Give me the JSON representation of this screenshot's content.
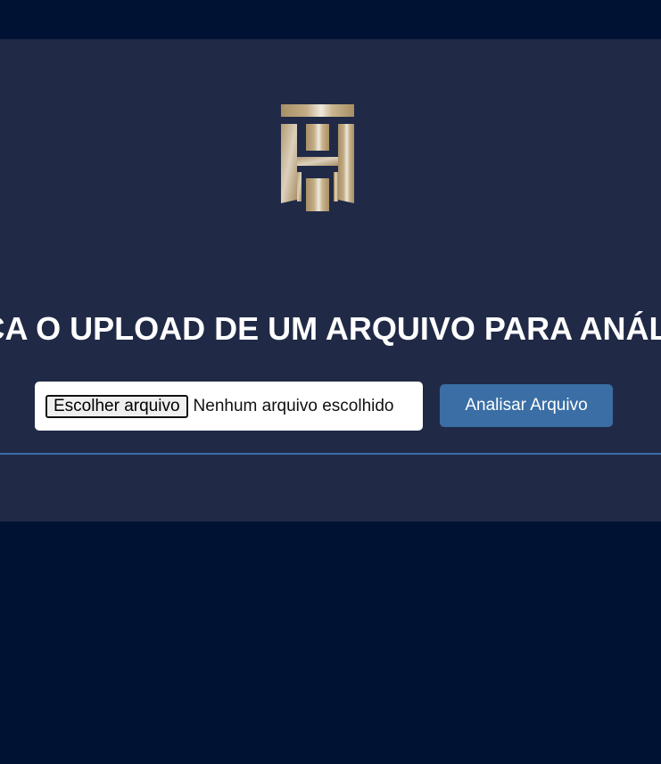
{
  "logo": {
    "icon": "th-monogram-logo",
    "colors": {
      "gold": "#b29a70",
      "light": "#e8e2d4"
    }
  },
  "page": {
    "title": "FAÇA O UPLOAD DE UM ARQUIVO PARA ANÁLISE"
  },
  "upload": {
    "choose_label": "Escolher arquivo",
    "status": "Nenhum arquivo escolhido",
    "submit_label": "Analisar Arquivo"
  },
  "colors": {
    "background": "#001233",
    "panel": "#202a47",
    "accent": "#3a6ea5"
  }
}
